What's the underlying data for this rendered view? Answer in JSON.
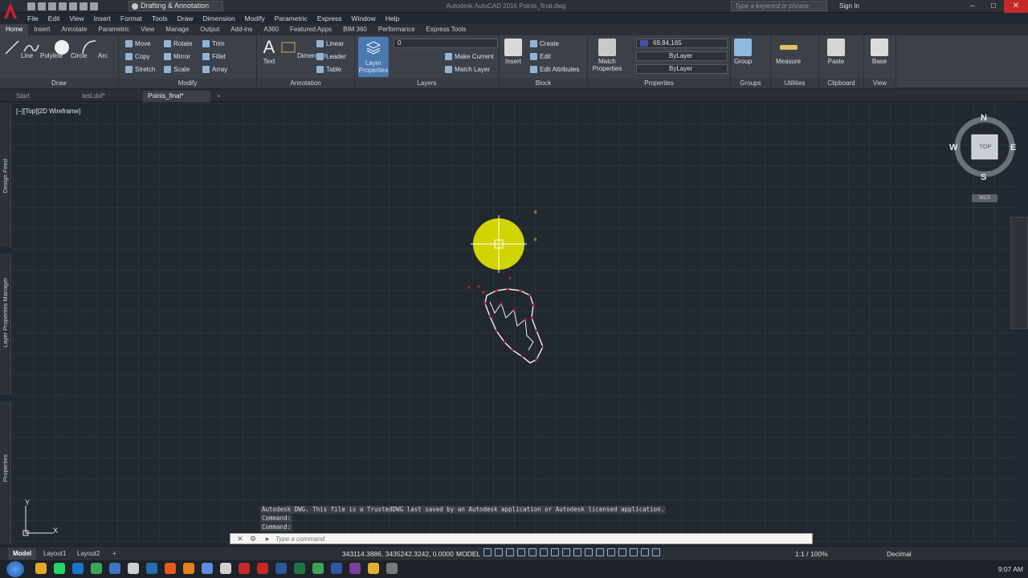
{
  "title_bar": {
    "workspace": "Drafting & Annotation",
    "title": "Autodesk AutoCAD 2016    Points_final.dwg",
    "search_placeholder": "Type a keyword or phrase",
    "signin": "Sign In"
  },
  "menu": [
    "File",
    "Edit",
    "View",
    "Insert",
    "Format",
    "Tools",
    "Draw",
    "Dimension",
    "Modify",
    "Parametric",
    "Express",
    "Window",
    "Help"
  ],
  "ribbon_tabs": [
    "Home",
    "Insert",
    "Annotate",
    "Parametric",
    "View",
    "Manage",
    "Output",
    "Add-ins",
    "A360",
    "Featured Apps",
    "BIM 360",
    "Performance",
    "Express Tools"
  ],
  "ribbon": {
    "draw": {
      "label": "Draw",
      "buttons": [
        "Line",
        "Polyline",
        "Circle",
        "Arc"
      ]
    },
    "modify": {
      "label": "Modify",
      "rows": [
        [
          "Move",
          "Rotate",
          "Trim"
        ],
        [
          "Copy",
          "Mirror",
          "Fillet"
        ],
        [
          "Stretch",
          "Scale",
          "Array"
        ]
      ]
    },
    "annotation": {
      "label": "Annotation",
      "text": "Text",
      "dimension": "Dimension",
      "linear": "Linear",
      "leader": "Leader",
      "table": "Table"
    },
    "layers": {
      "label": "Layers",
      "layer_properties": "Layer Properties",
      "layer_combo": "0",
      "make_current": "Make Current",
      "match_layer": "Match Layer"
    },
    "block": {
      "label": "Block",
      "insert": "Insert",
      "create": "Create",
      "edit": "Edit",
      "edit_attributes": "Edit Attributes"
    },
    "properties": {
      "label": "Properties",
      "match": "Match Properties",
      "color": "69,84,165",
      "linetype": "ByLayer",
      "lineweight": "ByLayer"
    },
    "groups": {
      "label": "Groups",
      "group": "Group"
    },
    "utilities": {
      "label": "Utilities",
      "measure": "Measure"
    },
    "clipboard": {
      "label": "Clipboard",
      "paste": "Paste"
    },
    "view": {
      "label": "View",
      "base": "Base"
    }
  },
  "doc_tabs": [
    "Start",
    "test.dxf*",
    "Points_final*"
  ],
  "viewport_label": "[−][Top][2D Wireframe]",
  "viewcube": {
    "n": "N",
    "s": "S",
    "e": "E",
    "w": "W",
    "face": "TOP",
    "wcs": "WCS"
  },
  "left_palettes": [
    "Design Feed",
    "Layer Properties Manager",
    "Properties"
  ],
  "command_history": [
    "Autodesk DWG.  This file is a TrustedDWG last saved by an Autodesk application or Autodesk licensed application.",
    "Command:",
    "Command:"
  ],
  "command_placeholder": "Type a command",
  "layout_tabs": [
    "Model",
    "Layout1",
    "Layout2"
  ],
  "status": {
    "coords": "343114.3886, 3435242.3242, 0.0000",
    "model": "MODEL",
    "scale": "1:1 / 100%",
    "units": "Decimal"
  },
  "ucs": {
    "x": "X",
    "y": "Y"
  },
  "clock": "9:07 AM",
  "colors": {
    "accent": "#2d6bb3",
    "canvas": "#212830",
    "highlight": "#e8e800",
    "points": "#c41e2e"
  }
}
